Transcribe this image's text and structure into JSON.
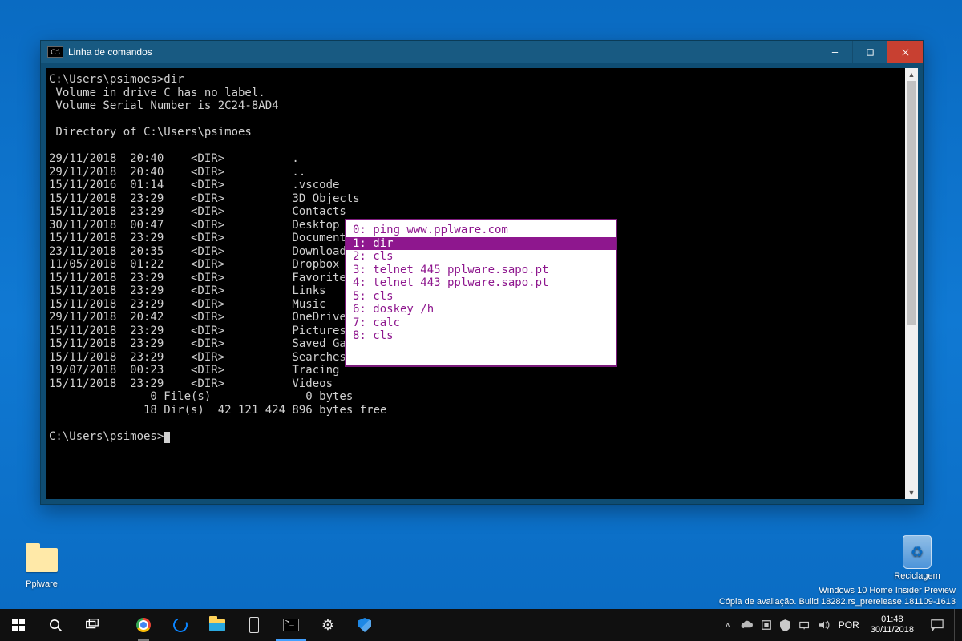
{
  "desktop": {
    "folder_label": "Pplware",
    "recycle_label": "Reciclagem"
  },
  "window": {
    "title": "Linha de comandos"
  },
  "console": {
    "prompt1": "C:\\Users\\psimoes>dir",
    "vol1": " Volume in drive C has no label.",
    "vol2": " Volume Serial Number is 2C24-8AD4",
    "dirof": " Directory of C:\\Users\\psimoes",
    "rows": [
      "29/11/2018  20:40    <DIR>          .",
      "29/11/2018  20:40    <DIR>          ..",
      "15/11/2016  01:14    <DIR>          .vscode",
      "15/11/2018  23:29    <DIR>          3D Objects",
      "15/11/2018  23:29    <DIR>          Contacts",
      "30/11/2018  00:47    <DIR>          Desktop",
      "15/11/2018  23:29    <DIR>          Documents",
      "23/11/2018  20:35    <DIR>          Downloads",
      "11/05/2018  01:22    <DIR>          Dropbox",
      "15/11/2018  23:29    <DIR>          Favorites",
      "15/11/2018  23:29    <DIR>          Links",
      "15/11/2018  23:29    <DIR>          Music",
      "29/11/2018  20:42    <DIR>          OneDrive",
      "15/11/2018  23:29    <DIR>          Pictures",
      "15/11/2018  23:29    <DIR>          Saved Games",
      "15/11/2018  23:29    <DIR>          Searches",
      "19/07/2018  00:23    <DIR>          Tracing",
      "15/11/2018  23:29    <DIR>          Videos"
    ],
    "summary1": "               0 File(s)              0 bytes",
    "summary2": "              18 Dir(s)  42 121 424 896 bytes free",
    "prompt2": "C:\\Users\\psimoes>"
  },
  "history": {
    "selected_index": 1,
    "items": [
      "0: ping www.pplware.com",
      "1: dir",
      "2: cls",
      "3: telnet 445 pplware.sapo.pt",
      "4: telnet 443 pplware.sapo.pt",
      "5: cls",
      "6: doskey /h",
      "7: calc",
      "8: cls"
    ]
  },
  "watermark": {
    "line1": "Windows 10 Home Insider Preview",
    "line2": "Cópia de avaliação. Build 18282.rs_prerelease.181109-1613"
  },
  "systray": {
    "lang": "POR",
    "time": "01:48",
    "date": "30/11/2018"
  }
}
